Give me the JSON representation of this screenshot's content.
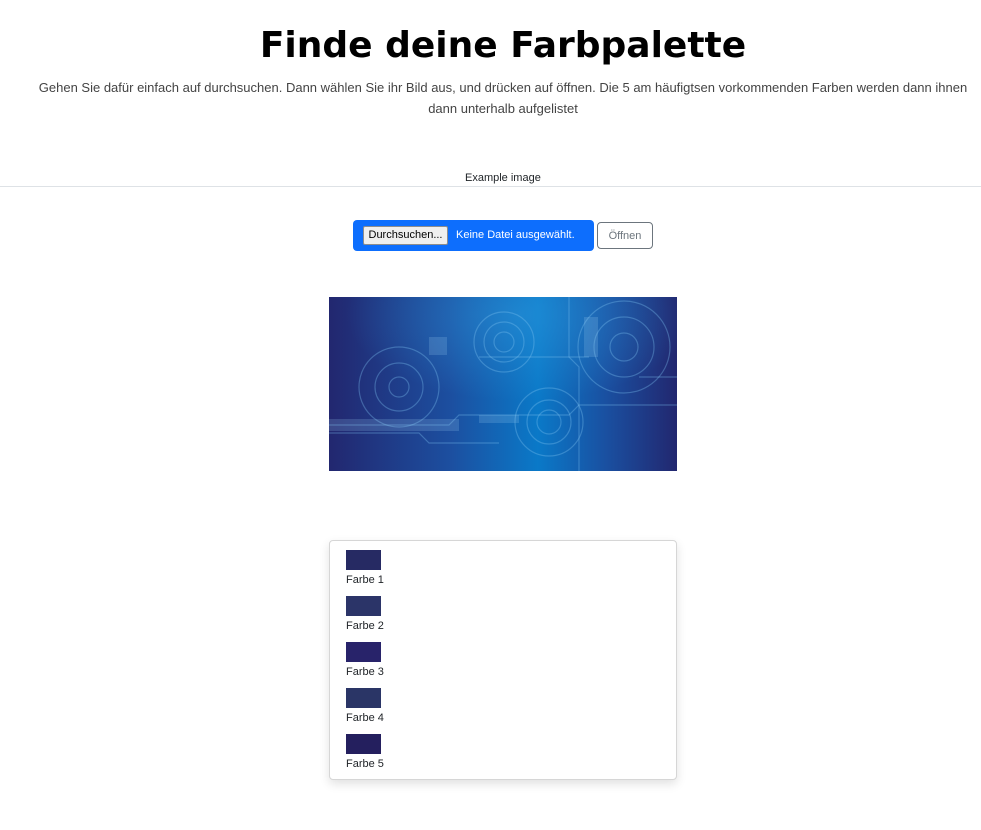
{
  "header": {
    "title": "Finde deine Farbpalette",
    "description": "Gehen Sie dafür einfach auf durchsuchen. Dann wählen Sie ihr Bild aus, und drücken auf öffnen. Die 5 am häufigtsen vorkommenden Farben werden dann ihnen dann unterhalb aufgelistet"
  },
  "example": {
    "label": "Example image"
  },
  "upload": {
    "browse_label": "Durchsuchen...",
    "status": "Keine Datei ausgewählt.",
    "open_label": "Öffnen",
    "accent_color": "#0d6efd"
  },
  "preview": {
    "colors": [
      "#22276f",
      "#1c4fa0",
      "#0a79c8"
    ]
  },
  "palette": {
    "colors": [
      {
        "label": "Farbe 1",
        "hex": "#262a63"
      },
      {
        "label": "Farbe 2",
        "hex": "#2b3468"
      },
      {
        "label": "Farbe 3",
        "hex": "#28236a"
      },
      {
        "label": "Farbe 4",
        "hex": "#2a3566"
      },
      {
        "label": "Farbe 5",
        "hex": "#241f5e"
      }
    ]
  }
}
